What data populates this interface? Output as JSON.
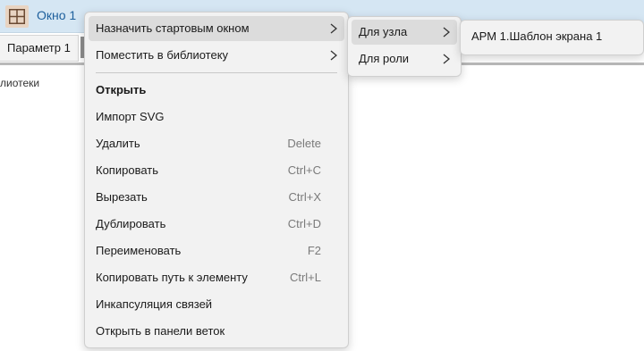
{
  "window": {
    "title": "Окно 1",
    "icon": "layout-grid-icon",
    "icon_color": "#e8d4c2"
  },
  "tab": {
    "label": "Параметр 1"
  },
  "background_text": "лиотеки",
  "context_menu": {
    "items": [
      {
        "label": "Назначить стартовым окном",
        "submenu": true,
        "highlighted": true
      },
      {
        "label": "Поместить в библиотеку",
        "submenu": true
      },
      {
        "label": "Открыть",
        "bold": true
      },
      {
        "label": "Импорт SVG"
      },
      {
        "label": "Удалить",
        "shortcut": "Delete"
      },
      {
        "label": "Копировать",
        "shortcut": "Ctrl+C"
      },
      {
        "label": "Вырезать",
        "shortcut": "Ctrl+X"
      },
      {
        "label": "Дублировать",
        "shortcut": "Ctrl+D"
      },
      {
        "label": "Переименовать",
        "shortcut": "F2"
      },
      {
        "label": "Копировать путь к элементу",
        "shortcut": "Ctrl+L"
      },
      {
        "label": "Инкапсуляция связей"
      },
      {
        "label": "Открыть в панели веток"
      }
    ]
  },
  "submenu_start_window": {
    "items": [
      {
        "label": "Для узла",
        "submenu": true,
        "highlighted": true
      },
      {
        "label": "Для роли",
        "submenu": true
      }
    ]
  },
  "submenu_node": {
    "items": [
      {
        "label": "АРМ 1.Шаблон экрана 1"
      }
    ]
  },
  "colors": {
    "title_bar": "#d5e6f3",
    "title_text": "#1d5f9c",
    "menu_bg": "#f2f2f2",
    "highlight": "#dcdcdc"
  }
}
